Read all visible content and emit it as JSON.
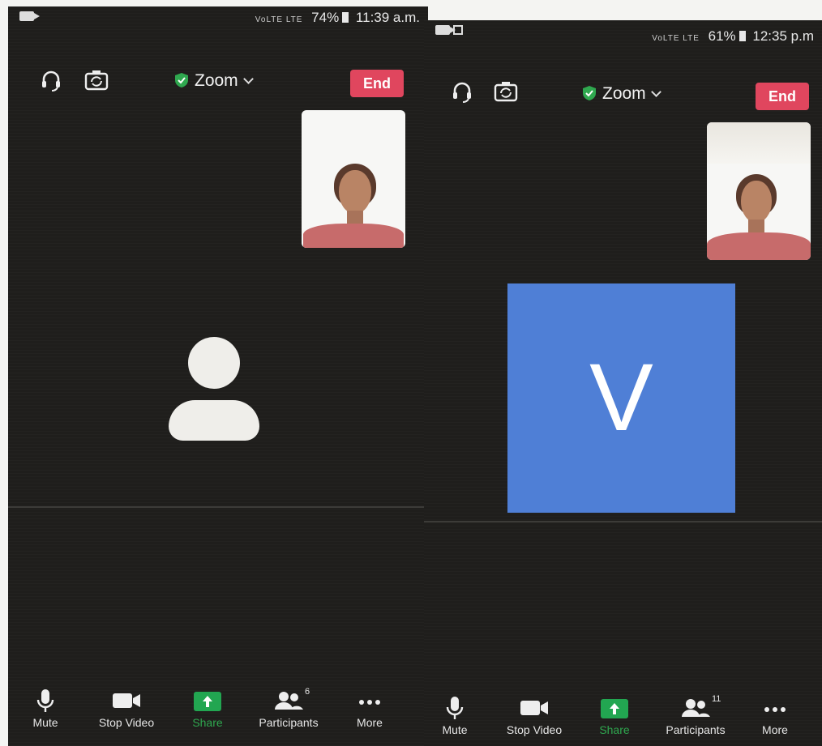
{
  "left_screen": {
    "status_bar": {
      "signal": "VoLTE LTE",
      "battery": "74%",
      "time": "11:39 a.m."
    },
    "header": {
      "meeting_title": "Zoom",
      "end_button": "End"
    },
    "toolbar": {
      "mute": "Mute",
      "stop_video": "Stop Video",
      "share": "Share",
      "participants": "Participants",
      "participants_count": "6",
      "more": "More"
    }
  },
  "right_screen": {
    "status_bar": {
      "signal": "VoLTE LTE",
      "battery": "61%",
      "time": "12:35 p.m"
    },
    "header": {
      "meeting_title": "Zoom",
      "end_button": "End"
    },
    "active_speaker": {
      "initial": "V",
      "tile_color": "#4f7fd6"
    },
    "toolbar": {
      "mute": "Mute",
      "stop_video": "Stop Video",
      "share": "Share",
      "participants": "Participants",
      "participants_count": "11",
      "more": "More"
    }
  },
  "colors": {
    "background": "#1f1e1c",
    "end_button": "#e0465e",
    "share_accent": "#22a651",
    "secure_shield": "#2fa84f"
  },
  "icons": [
    "audio-headset-icon",
    "flip-camera-icon",
    "shield-check-icon",
    "chevron-down-icon",
    "microphone-icon",
    "video-camera-icon",
    "share-arrow-icon",
    "participants-icon",
    "more-dots-icon",
    "avatar-placeholder-icon"
  ]
}
